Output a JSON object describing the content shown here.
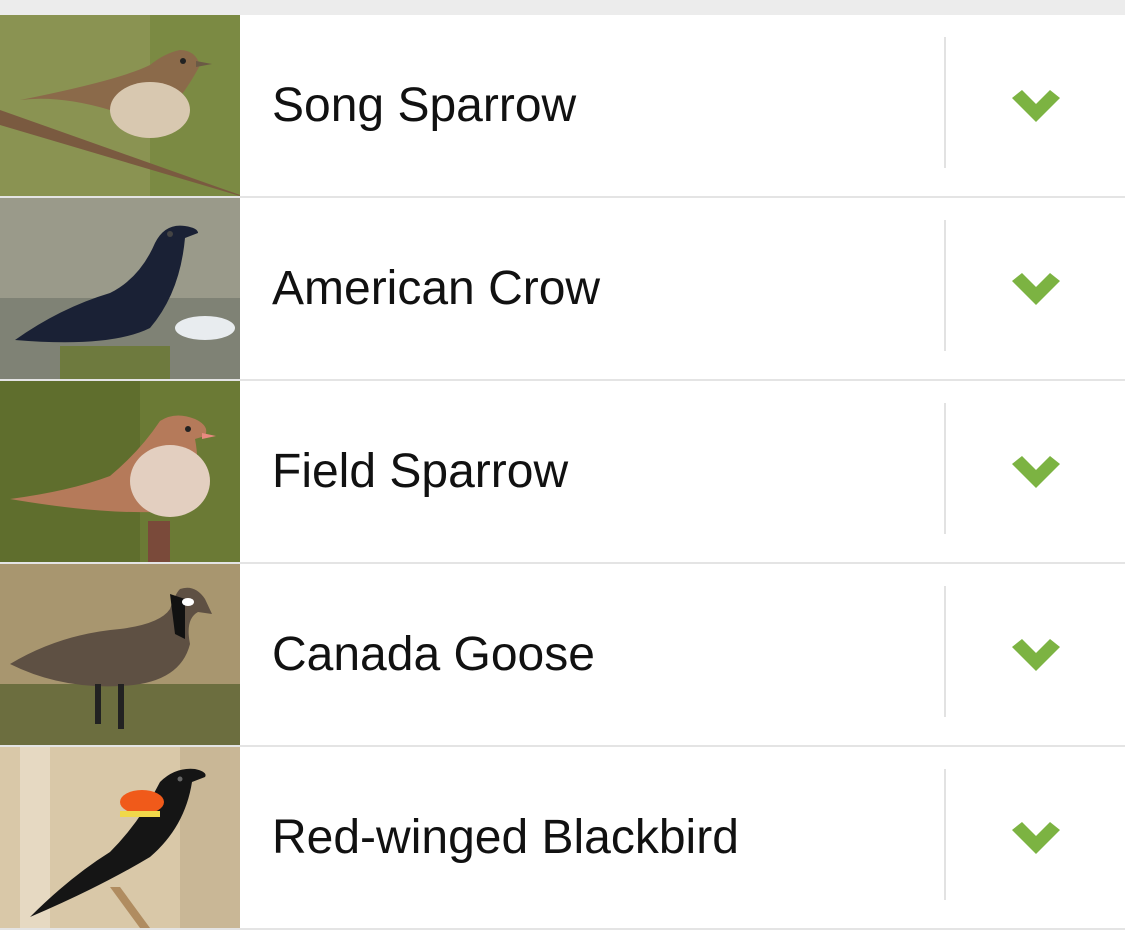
{
  "accent": "#7cb342",
  "birds": [
    {
      "name": "Song Sparrow",
      "checked": true,
      "icon": "checkmark-icon"
    },
    {
      "name": "American Crow",
      "checked": true,
      "icon": "checkmark-icon"
    },
    {
      "name": "Field Sparrow",
      "checked": true,
      "icon": "checkmark-icon"
    },
    {
      "name": "Canada Goose",
      "checked": true,
      "icon": "checkmark-icon"
    },
    {
      "name": "Red-winged Blackbird",
      "checked": true,
      "icon": "checkmark-icon"
    }
  ]
}
